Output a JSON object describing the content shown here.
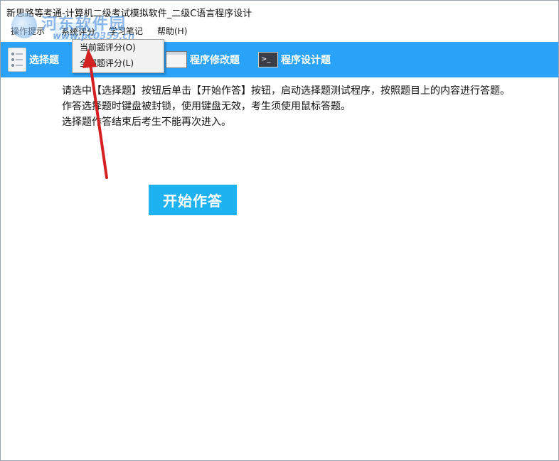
{
  "window": {
    "title": "新思路等考通-计算机二级考试模拟软件_二级C语言程序设计"
  },
  "watermark": {
    "site_name": "河东软件园",
    "url": "www.pc0359.cn"
  },
  "menubar": {
    "items": [
      {
        "label": "操作提示"
      },
      {
        "label": "系统评分"
      },
      {
        "label": "学习笔记"
      },
      {
        "label": "帮助(H)"
      }
    ]
  },
  "dropdown": {
    "items": [
      {
        "label": "当前题评分(O)"
      },
      {
        "label": "全部题评分(L)"
      }
    ]
  },
  "toolbar": {
    "buttons": [
      {
        "label": "选择题",
        "icon": "checklist-icon"
      },
      {
        "label": "程序修改题",
        "icon": "window-icon"
      },
      {
        "label": "程序设计题",
        "icon": "terminal-icon"
      }
    ]
  },
  "instructions": [
    "请选中【选择题】按钮后单击【开始作答】按钮，启动选择题测试程序，按照题目上的内容进行答题。",
    "作答选择题时键盘被封锁，使用键盘无效，考生须使用鼠标答题。",
    "选择题作答结束后考生不能再次进入。"
  ],
  "start_button": {
    "label": "开始作答"
  },
  "colors": {
    "toolbar": "#2aa2f8",
    "start_button": "#1eb3f0",
    "annotation_arrow": "#d32020"
  }
}
